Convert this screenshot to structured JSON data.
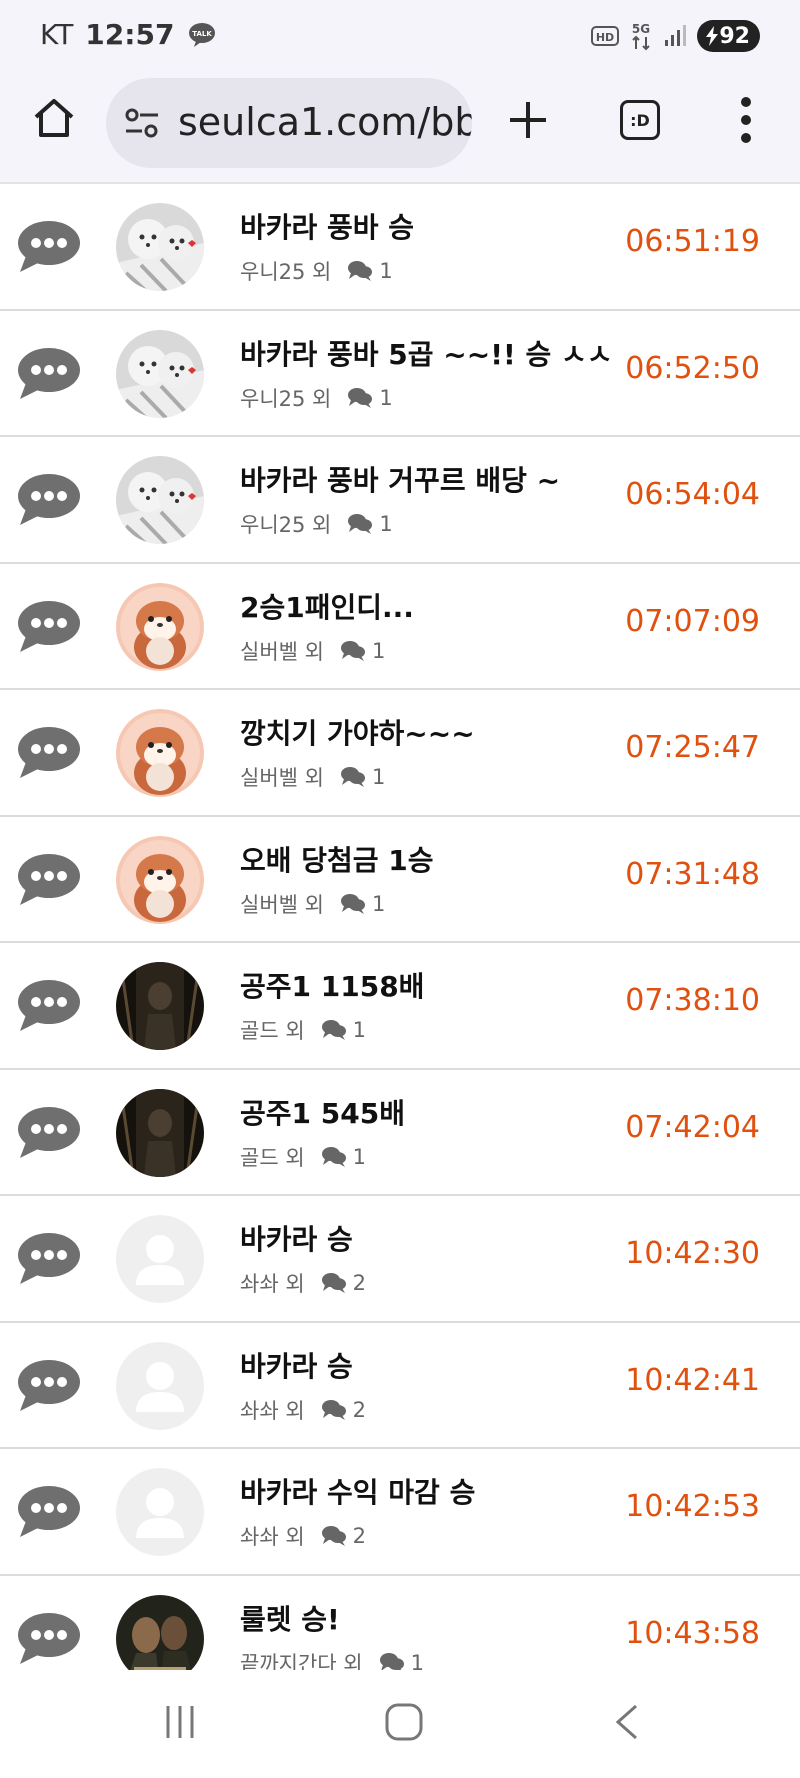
{
  "status_bar": {
    "carrier": "KT",
    "time": "12:57",
    "notification_icon": "kakaotalk-icon",
    "talk_label": "TALK",
    "hd_label": "HD",
    "network_label": "5G",
    "battery": "92"
  },
  "browser": {
    "url": "seulca1.com/bb",
    "tabs_label": ":D"
  },
  "posts": [
    {
      "title": "바카라 풍바 승",
      "author": "우니25 외",
      "comments": "1",
      "time": "06:51:19",
      "avatar": "puppy"
    },
    {
      "title": "바카라 풍바 5곱 ~~!! 승 ㅅㅅ",
      "author": "우니25 외",
      "comments": "1",
      "time": "06:52:50",
      "avatar": "puppy"
    },
    {
      "title": "바카라 풍바 거꾸르 배당 ~",
      "author": "우니25 외",
      "comments": "1",
      "time": "06:54:04",
      "avatar": "puppy"
    },
    {
      "title": "2승1패인디...",
      "author": "실버벨 외",
      "comments": "1",
      "time": "07:07:09",
      "avatar": "otter"
    },
    {
      "title": "깡치기 가야하~~~",
      "author": "실버벨 외",
      "comments": "1",
      "time": "07:25:47",
      "avatar": "otter"
    },
    {
      "title": "오배 당첨금 1승",
      "author": "실버벨 외",
      "comments": "1",
      "time": "07:31:48",
      "avatar": "otter"
    },
    {
      "title": "공주1 1158배",
      "author": "골드 외",
      "comments": "1",
      "time": "07:38:10",
      "avatar": "dark"
    },
    {
      "title": "공주1 545배",
      "author": "골드 외",
      "comments": "1",
      "time": "07:42:04",
      "avatar": "dark"
    },
    {
      "title": "바카라 승",
      "author": "솨솨 외",
      "comments": "2",
      "time": "10:42:30",
      "avatar": "default"
    },
    {
      "title": "바카라 승",
      "author": "솨솨 외",
      "comments": "2",
      "time": "10:42:41",
      "avatar": "default"
    },
    {
      "title": "바카라 수익 마감 승",
      "author": "솨솨 외",
      "comments": "2",
      "time": "10:42:53",
      "avatar": "default"
    },
    {
      "title": "룰렛 승!",
      "author": "끝까지간다 외",
      "comments": "1",
      "time": "10:43:58",
      "avatar": "movie"
    }
  ],
  "colors": {
    "time": "#e0500e",
    "chrome_background": "#f5f4fb",
    "url_pill": "#e6e5ee",
    "chat_icon": "#6f6f6f"
  },
  "icons": {
    "row_icon": "chat-bubble-dots-icon",
    "comment_icon": "comment-bubbles-icon",
    "home": "home-icon",
    "new_tab": "plus-icon",
    "menu": "more-vert-icon",
    "nav_recent": "recent-apps-icon",
    "nav_home": "nav-home-icon",
    "nav_back": "back-icon"
  }
}
